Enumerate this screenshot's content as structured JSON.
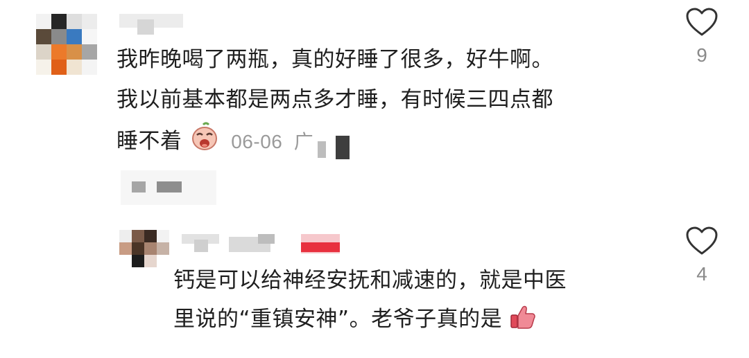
{
  "comments": [
    {
      "lines": [
        "我昨晚喝了两瓶，真的好睡了很多，好牛啊。",
        "我以前基本都是两点多才睡，有时候三四点都",
        "睡不着"
      ],
      "date": "06-06",
      "location_fragment": "广",
      "likes": "9"
    },
    {
      "lines": [
        "钙是可以给神经安抚和减速的，就是中医",
        "里说的“重镇安神”。老爷子真的是"
      ],
      "likes": "4"
    }
  ],
  "icons": {
    "like": "heart-outline-icon",
    "crying_emoji": "crying-face-emoji-icon",
    "thumbs_up_emoji": "thumbs-up-emoji-icon"
  },
  "colors": {
    "text": "#1f1f1f",
    "meta": "#9a9a9a",
    "heart_stroke": "#333333"
  }
}
